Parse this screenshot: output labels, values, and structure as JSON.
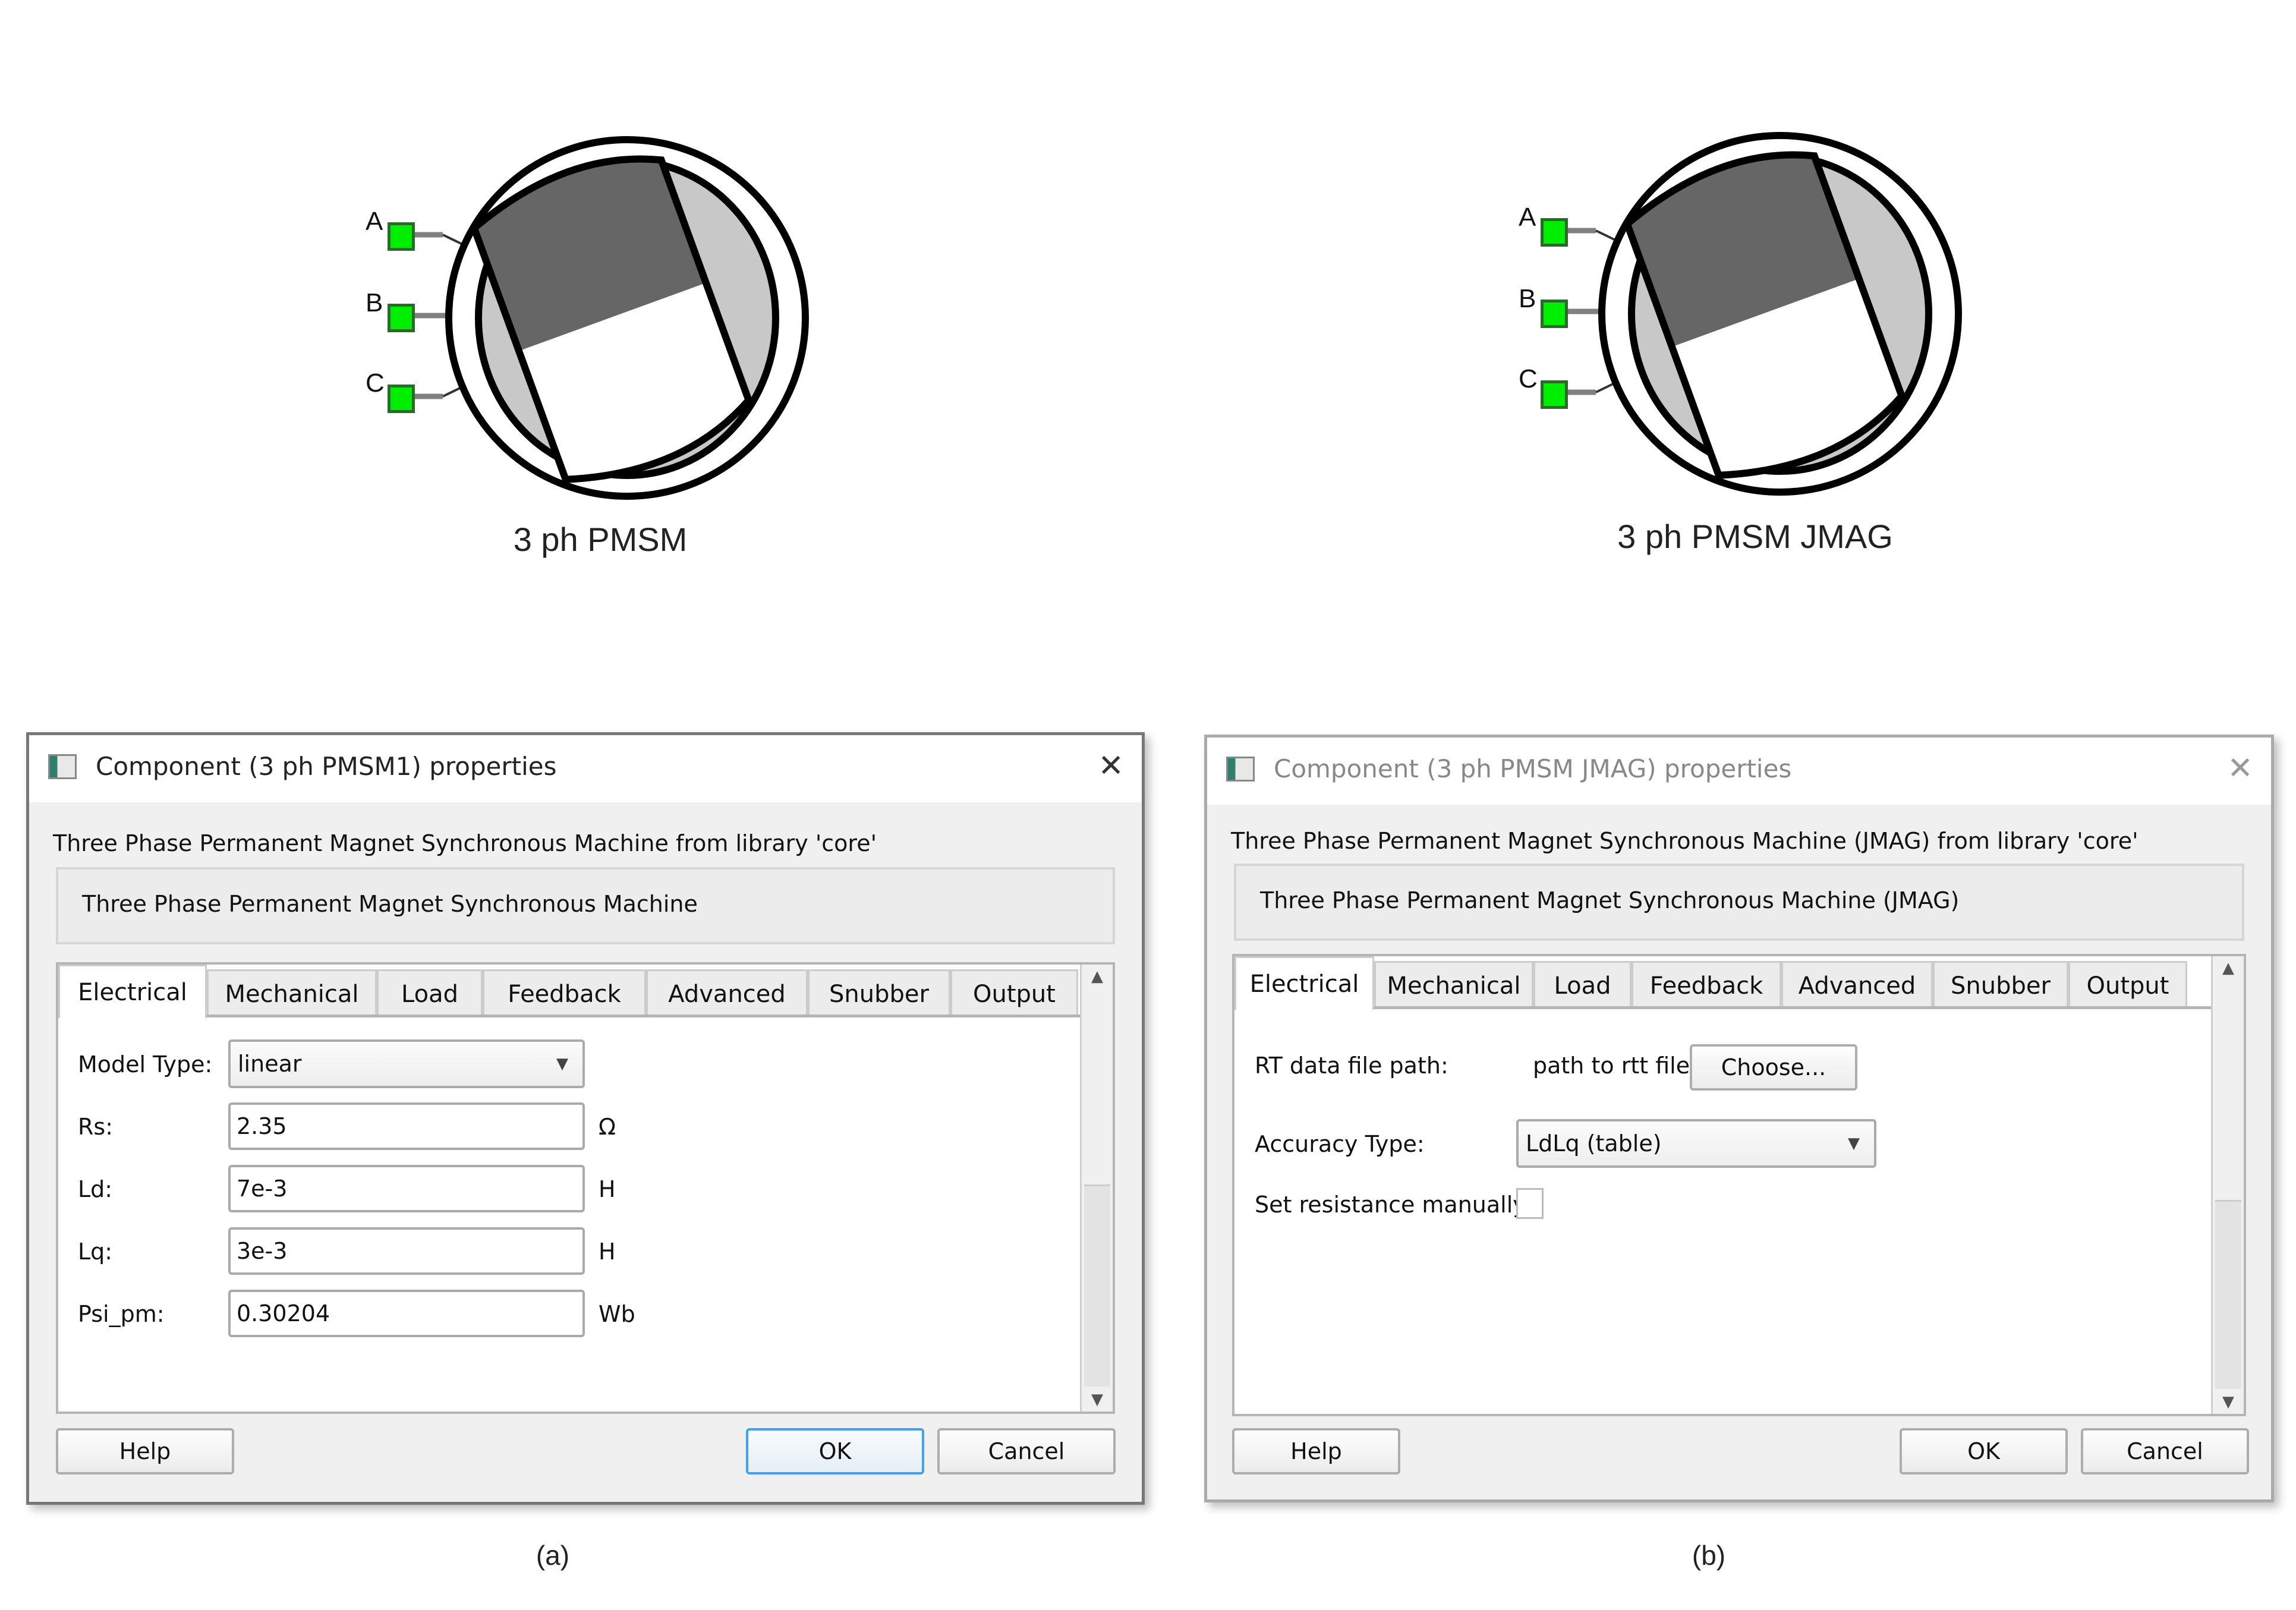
{
  "symbols": [
    {
      "label": "3 ph PMSM",
      "ports": [
        "A",
        "B",
        "C"
      ]
    },
    {
      "label": "3 ph PMSM JMAG",
      "ports": [
        "A",
        "B",
        "C"
      ]
    }
  ],
  "colors": {
    "port": "#00ee00",
    "rotor_dark": "#666666",
    "stator": "#c8c8c8",
    "ok_focus": "#3da2f3"
  },
  "dialog_a": {
    "title": "Component (3 ph PMSM1) properties",
    "description": "Three Phase Permanent Magnet Synchronous Machine from library 'core'",
    "descbox": "Three Phase Permanent Magnet Synchronous Machine",
    "tabs": [
      "Electrical",
      "Mechanical",
      "Load",
      "Feedback",
      "Advanced",
      "Snubber",
      "Output"
    ],
    "active_tab": "Electrical",
    "model_type": {
      "label": "Model Type:",
      "value": "linear"
    },
    "fields": [
      {
        "label": "Rs:",
        "value": "2.35",
        "unit": "Ω"
      },
      {
        "label": "Ld:",
        "value": "7e-3",
        "unit": "H"
      },
      {
        "label": "Lq:",
        "value": "3e-3",
        "unit": "H"
      },
      {
        "label": "Psi_pm:",
        "value": "0.30204",
        "unit": "Wb"
      }
    ],
    "buttons": {
      "help": "Help",
      "ok": "OK",
      "cancel": "Cancel"
    },
    "caption": "(a)"
  },
  "dialog_b": {
    "title": "Component (3 ph PMSM JMAG) properties",
    "description": "Three Phase Permanent Magnet Synchronous Machine (JMAG) from library 'core'",
    "descbox": "Three Phase Permanent Magnet Synchronous Machine (JMAG)",
    "tabs": [
      "Electrical",
      "Mechanical",
      "Load",
      "Feedback",
      "Advanced",
      "Snubber",
      "Output"
    ],
    "active_tab": "Electrical",
    "rt_path": {
      "label": "RT data file path:",
      "value": "path to rtt file",
      "button": "Choose..."
    },
    "accuracy": {
      "label": "Accuracy Type:",
      "value": "LdLq (table)"
    },
    "set_resistance": {
      "label": "Set resistance manually:",
      "checked": false
    },
    "buttons": {
      "help": "Help",
      "ok": "OK",
      "cancel": "Cancel"
    },
    "caption": "(b)"
  },
  "icons": {
    "close": "✕",
    "dropdown": "▼",
    "scroll_up": "▲",
    "scroll_down": "▼"
  }
}
